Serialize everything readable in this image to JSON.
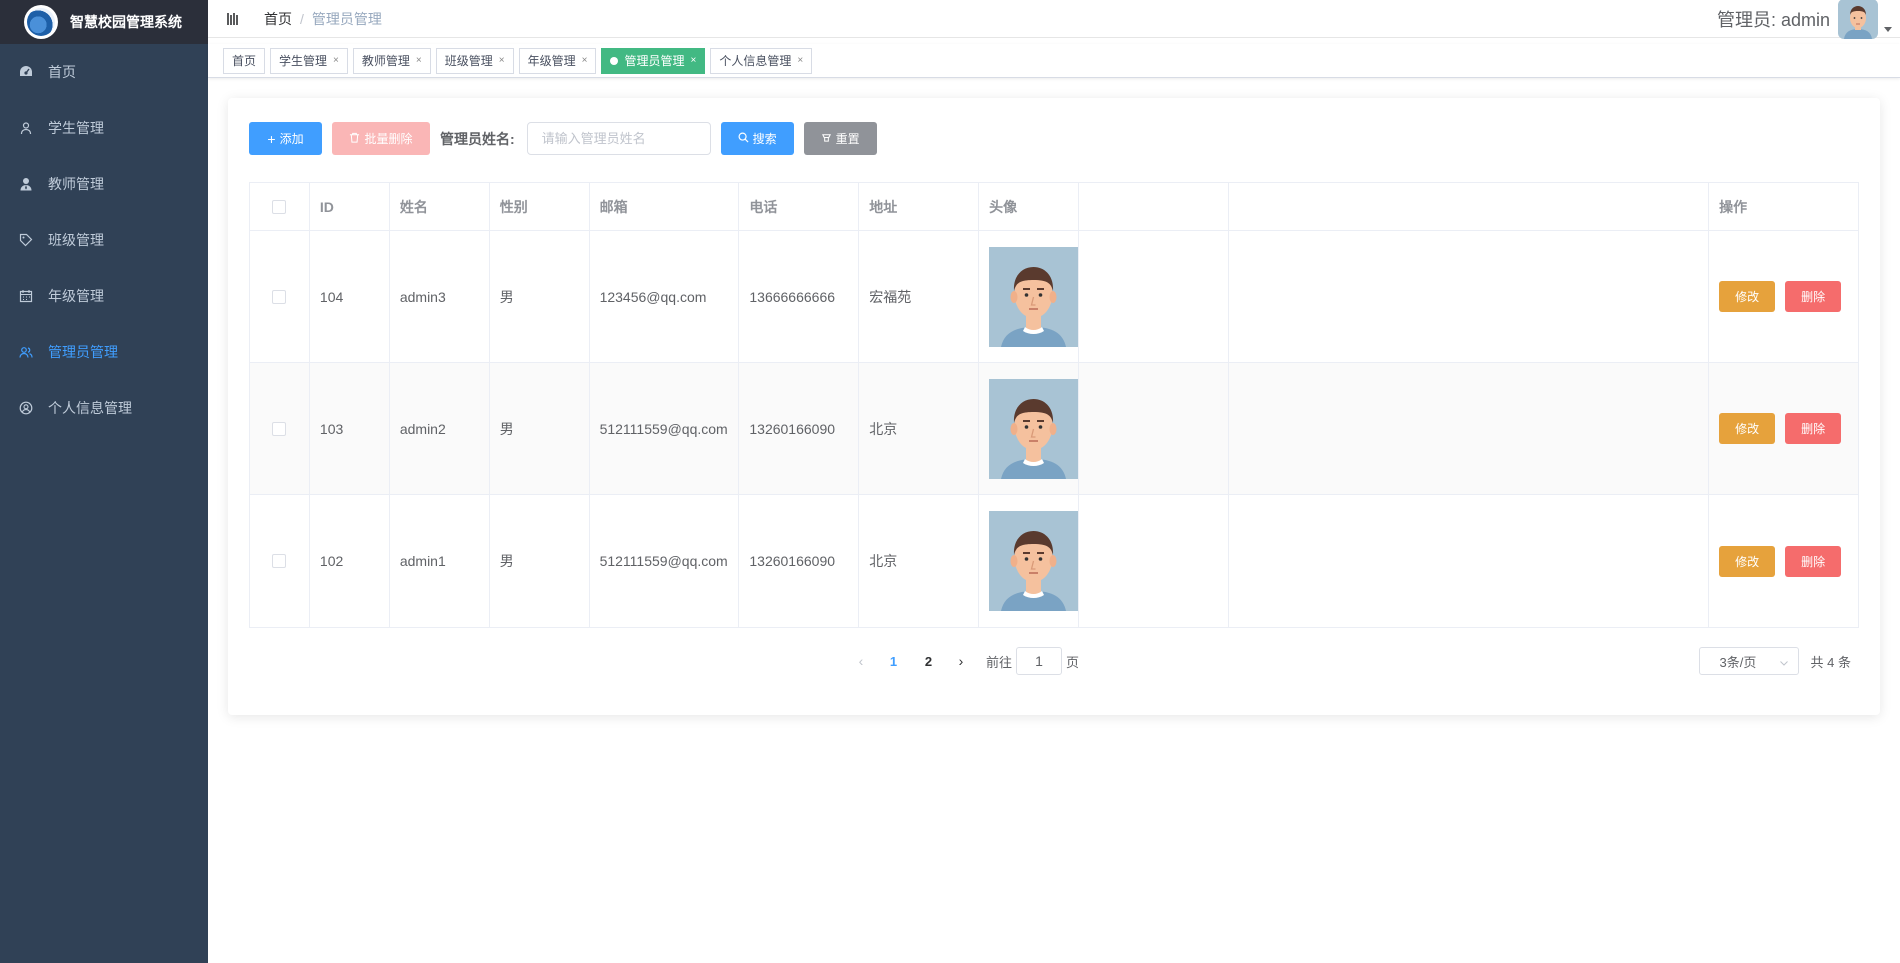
{
  "app": {
    "title": "智慧校园管理系统"
  },
  "sidebar": {
    "items": [
      {
        "label": "首页",
        "icon": "dashboard-icon",
        "active": false
      },
      {
        "label": "学生管理",
        "icon": "user-icon",
        "active": false
      },
      {
        "label": "教师管理",
        "icon": "teacher-icon",
        "active": false
      },
      {
        "label": "班级管理",
        "icon": "tag-icon",
        "active": false
      },
      {
        "label": "年级管理",
        "icon": "calendar-icon",
        "active": false
      },
      {
        "label": "管理员管理",
        "icon": "users-icon",
        "active": true
      },
      {
        "label": "个人信息管理",
        "icon": "profile-icon",
        "active": false
      }
    ]
  },
  "header": {
    "breadcrumb_home": "首页",
    "breadcrumb_separator": "/",
    "breadcrumb_current": "管理员管理",
    "user_label": "管理员: admin"
  },
  "tags": [
    {
      "label": "首页",
      "closable": false,
      "active": false
    },
    {
      "label": "学生管理",
      "closable": true,
      "active": false
    },
    {
      "label": "教师管理",
      "closable": true,
      "active": false
    },
    {
      "label": "班级管理",
      "closable": true,
      "active": false
    },
    {
      "label": "年级管理",
      "closable": true,
      "active": false
    },
    {
      "label": "管理员管理",
      "closable": true,
      "active": true
    },
    {
      "label": "个人信息管理",
      "closable": true,
      "active": false
    }
  ],
  "toolbar": {
    "add_label": "添加",
    "batch_delete_label": "批量删除",
    "search_label": "管理员姓名:",
    "search_placeholder": "请输入管理员姓名",
    "search_value": "",
    "search_button": "搜索",
    "reset_button": "重置"
  },
  "table": {
    "headers": {
      "id": "ID",
      "name": "姓名",
      "sex": "性别",
      "email": "邮箱",
      "phone": "电话",
      "address": "地址",
      "avatar": "头像",
      "ops": "操作"
    },
    "rows": [
      {
        "id": "104",
        "name": "admin3",
        "sex": "男",
        "email": "123456@qq.com",
        "phone": "13666666666",
        "address": "宏福苑"
      },
      {
        "id": "103",
        "name": "admin2",
        "sex": "男",
        "email": "512111559@qq.com",
        "phone": "13260166090",
        "address": "北京"
      },
      {
        "id": "102",
        "name": "admin1",
        "sex": "男",
        "email": "512111559@qq.com",
        "phone": "13260166090",
        "address": "北京"
      }
    ],
    "edit_label": "修改",
    "delete_label": "删除"
  },
  "pagination": {
    "pages": [
      "1",
      "2"
    ],
    "current_page": "1",
    "goto_prefix": "前往",
    "goto_value": "1",
    "goto_suffix": "页",
    "page_size": "3条/页",
    "total": "共 4 条"
  },
  "colors": {
    "sidebar_bg": "#304156",
    "primary": "#409eff",
    "active_tag": "#42b983",
    "warning": "#e6a23c",
    "danger": "#f56c6c"
  }
}
